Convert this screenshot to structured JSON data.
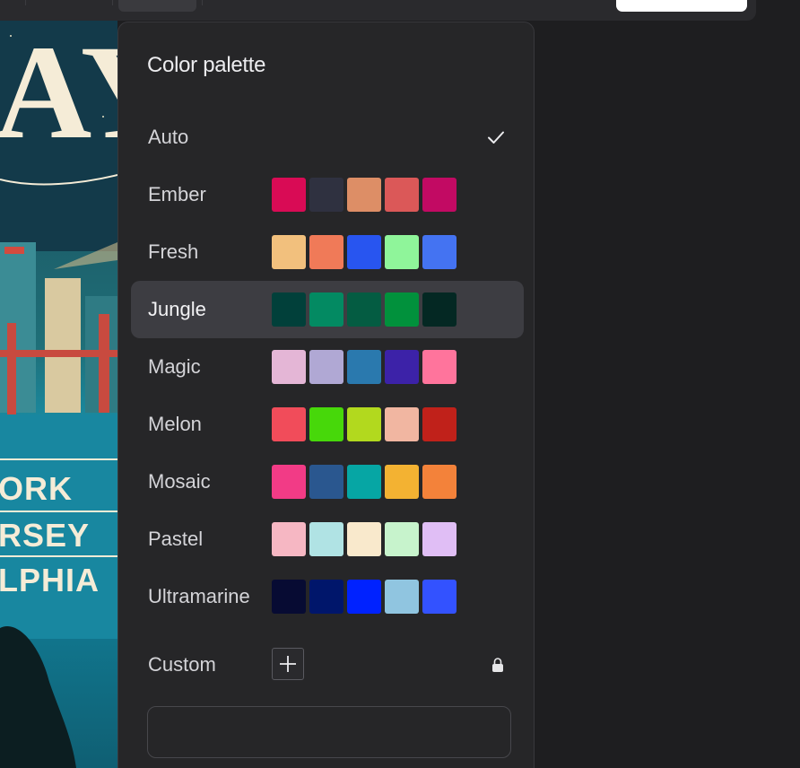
{
  "panel": {
    "title": "Color palette",
    "palettes": [
      {
        "name": "Auto",
        "selected": true,
        "colors": []
      },
      {
        "name": "Ember",
        "colors": [
          "#d90b55",
          "#2f3140",
          "#dd8e66",
          "#db5858",
          "#c20a63"
        ]
      },
      {
        "name": "Fresh",
        "colors": [
          "#f2c07d",
          "#f07a58",
          "#2855f0",
          "#8ff59a",
          "#4473f2"
        ]
      },
      {
        "name": "Jungle",
        "highlighted": true,
        "colors": [
          "#01403a",
          "#038a62",
          "#045c42",
          "#01913c",
          "#042823"
        ]
      },
      {
        "name": "Magic",
        "colors": [
          "#e4b6d6",
          "#b0a8d4",
          "#2a79ae",
          "#3c22a8",
          "#ff749c"
        ]
      },
      {
        "name": "Melon",
        "colors": [
          "#f14c5a",
          "#47d80a",
          "#b2d91e",
          "#f1b6a1",
          "#c0211a"
        ]
      },
      {
        "name": "Mosaic",
        "colors": [
          "#f23b86",
          "#2a578f",
          "#06a6a4",
          "#f3b232",
          "#f3823a"
        ]
      },
      {
        "name": "Pastel",
        "colors": [
          "#f6b7c3",
          "#b0e3e4",
          "#f9e9cc",
          "#c7f3cc",
          "#e0bef5"
        ]
      },
      {
        "name": "Ultramarine",
        "colors": [
          "#070b33",
          "#00166b",
          "#0022ff",
          "#90c5e0",
          "#3352ff"
        ]
      }
    ],
    "custom": {
      "label": "Custom",
      "add_icon": "plus-icon",
      "lock_icon": "lock-icon",
      "input_value": "",
      "input_placeholder": ""
    },
    "check_icon": "check-icon"
  },
  "poster": {
    "words": [
      "AY",
      "ORK",
      "RSEY",
      "LPHIA"
    ]
  },
  "colors": {
    "panel_bg": "#262628",
    "row_highlight": "#3d3d42",
    "text": "#d4d4d8",
    "app_bg": "#1e1e20"
  }
}
